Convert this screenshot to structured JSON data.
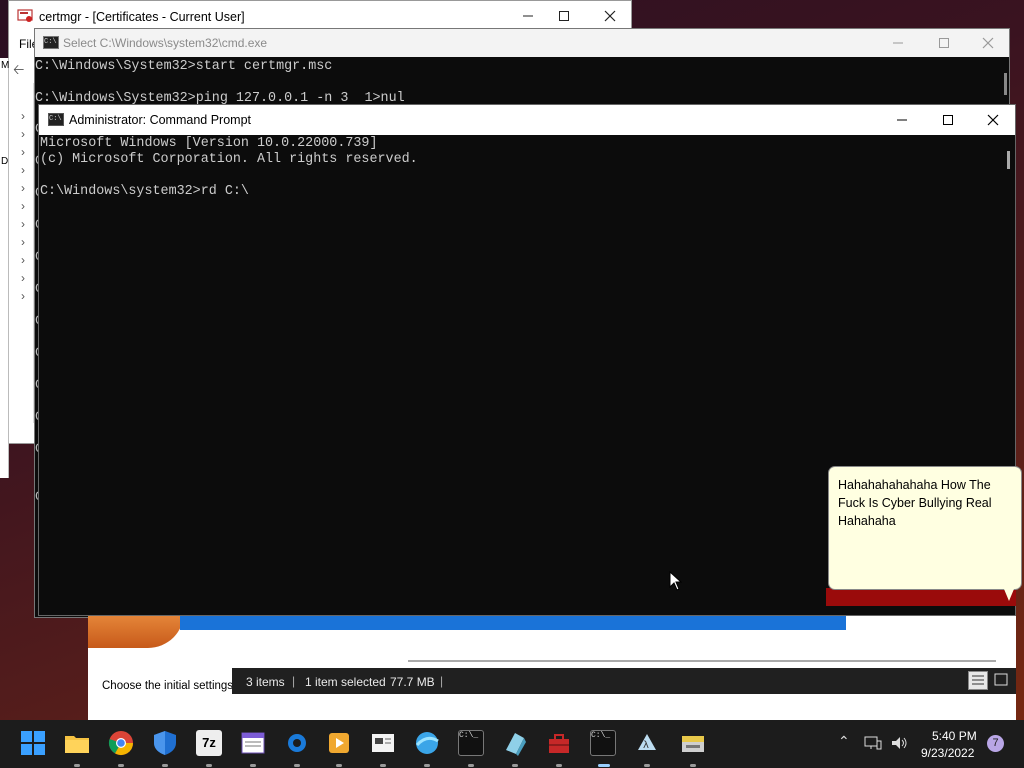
{
  "certmgr": {
    "title": "certmgr - [Certificates - Current User]",
    "menu_file": "File",
    "left_stub_letters": [
      "M",
      "D"
    ]
  },
  "cmd_back": {
    "title": "Select C:\\Windows\\system32\\cmd.exe",
    "lines": [
      "C:\\Windows\\System32>start certmgr.msc",
      "",
      "C:\\Windows\\System32>ping 127.0.0.1 -n 3  1>nul"
    ],
    "left_stubs": [
      "C",
      "C",
      "C",
      "C",
      "C",
      "C",
      "C",
      "C",
      "C",
      "C",
      "C",
      "C"
    ]
  },
  "cmd_admin": {
    "title": "Administrator: Command Prompt",
    "lines": [
      "Microsoft Windows [Version 10.0.22000.739]",
      "(c) Microsoft Corporation. All rights reserved.",
      "",
      "C:\\Windows\\system32>rd C:\\"
    ]
  },
  "explorer": {
    "setup_text": "Choose the initial settings f",
    "status_items": "3 items",
    "status_selected": "1 item selected",
    "status_size": "77.7 MB"
  },
  "bubble": {
    "text": "Hahahahahahaha How The Fuck Is Cyber Bullying Real Hahahaha"
  },
  "taskbar": {
    "time": "5:40 PM",
    "date": "9/23/2022",
    "notification_count": "7",
    "apps": [
      "start-icon",
      "file-explorer-icon",
      "chrome-icon",
      "windows-security-icon",
      "7zip-icon",
      "notepad-icon",
      "app-gear-icon",
      "media-player-icon",
      "news-icon",
      "browser-icon",
      "cmd-icon",
      "app-cube-icon",
      "app-toolbox-icon",
      "cmd-active-icon",
      "app-lambda-icon",
      "app-tray-icon"
    ]
  },
  "colors": {
    "console_bg": "#0c0c0c",
    "console_text": "#cccccc",
    "bubble_bg": "#ffffe1",
    "taskbar_bg": "#1c1c1c",
    "accent": "#1a73d8"
  }
}
